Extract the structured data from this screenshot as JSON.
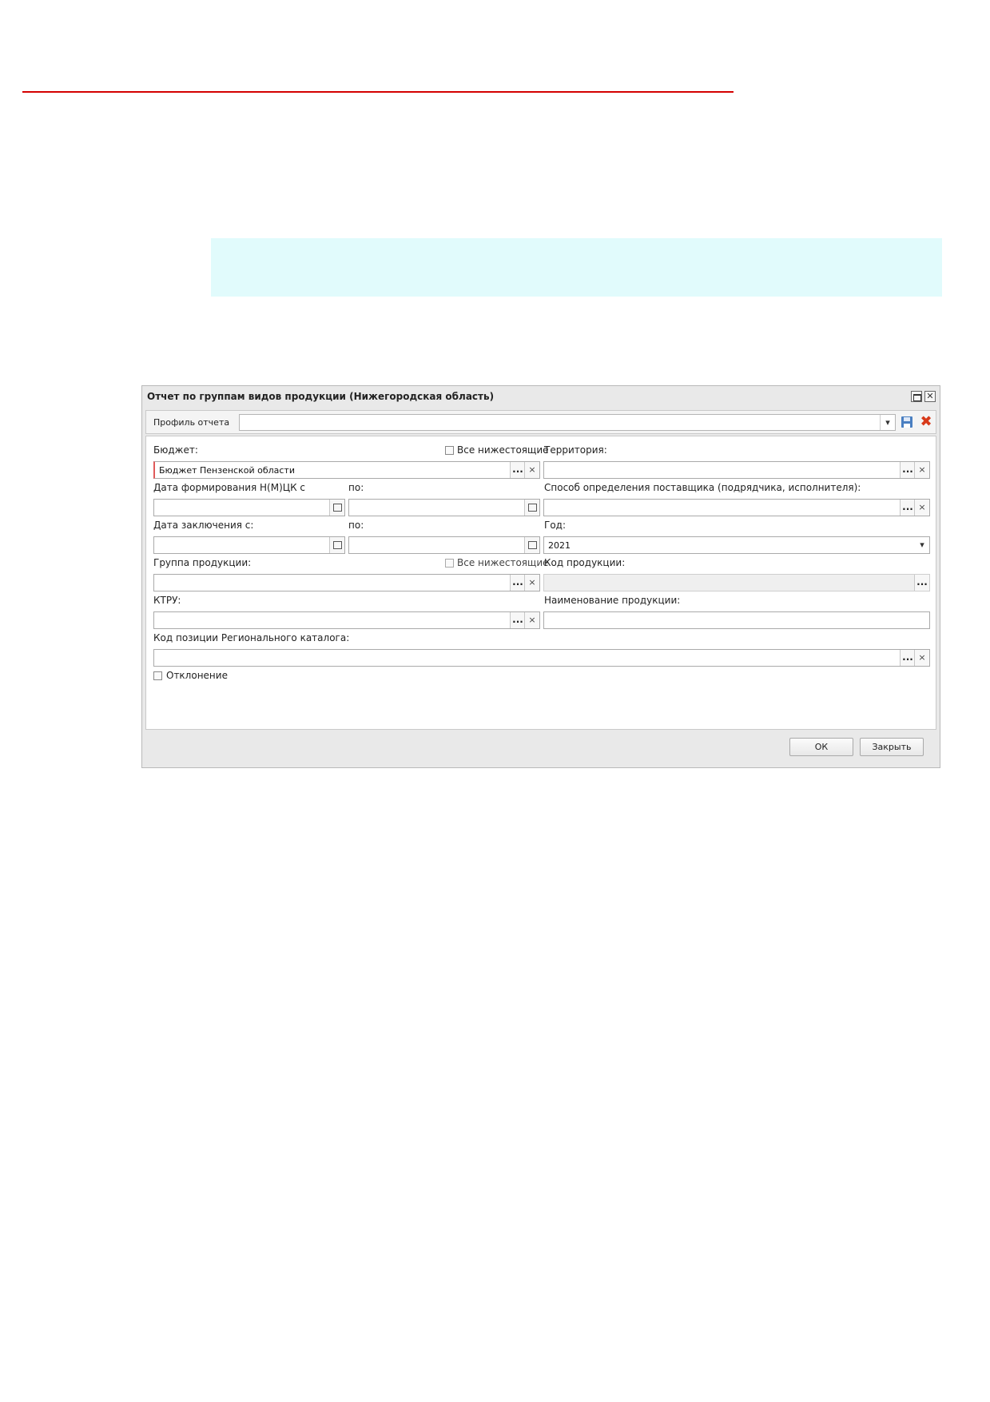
{
  "dialog": {
    "title": "Отчет по группам видов продукции (Нижегородская область)",
    "profile_label": "Профиль отчета",
    "profile_value": ""
  },
  "form": {
    "budget_label": "Бюджет:",
    "budget_all_label": "Все нижестоящие",
    "budget_value": "Бюджет Пензенской области",
    "territory_label": "Территория:",
    "nmck_date_label": "Дата формирования Н(М)ЦК с",
    "nmck_to_label": "по:",
    "supplier_method_label": "Способ определения поставщика (подрядчика, исполнителя):",
    "contract_date_label": "Дата заключения с:",
    "contract_to_label": "по:",
    "year_label": "Год:",
    "year_value": "2021",
    "product_group_label": "Группа продукции:",
    "product_group_all_label": "Все нижестоящие",
    "product_code_label": "Код продукции:",
    "ktru_label": "КТРУ:",
    "product_name_label": "Наименование продукции:",
    "regional_catalog_label": "Код позиции Регионального каталога:",
    "deviation_label": "Отклонение"
  },
  "buttons": {
    "ok": "ОК",
    "close": "Закрыть",
    "dots": "...",
    "clear": "×"
  }
}
